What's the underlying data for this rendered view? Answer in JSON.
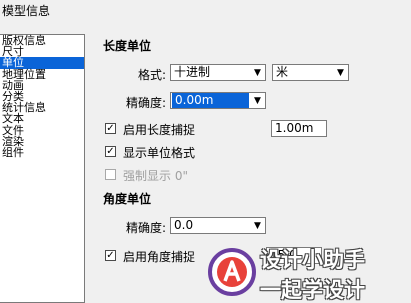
{
  "window": {
    "title": "模型信息"
  },
  "sidebar": {
    "items": [
      {
        "label": "版权信息"
      },
      {
        "label": "尺寸"
      },
      {
        "label": "单位",
        "selected": true
      },
      {
        "label": "地理位置"
      },
      {
        "label": "动画"
      },
      {
        "label": "分类"
      },
      {
        "label": "统计信息"
      },
      {
        "label": "文本"
      },
      {
        "label": "文件"
      },
      {
        "label": "渲染"
      },
      {
        "label": "组件"
      }
    ]
  },
  "length": {
    "section_title": "长度单位",
    "format_label": "格式:",
    "format_value": "十进制",
    "unit_value": "米",
    "precision_label": "精确度:",
    "precision_value": "0.00m",
    "snap_label": "启用长度捕捉",
    "snap_checked": true,
    "snap_value": "1.00m",
    "show_format_label": "显示单位格式",
    "show_format_checked": true,
    "force_label": "强制显示 0\"",
    "force_checked": false
  },
  "angle": {
    "section_title": "角度单位",
    "precision_label": "精确度:",
    "precision_value": "0.0",
    "snap_label": "启用角度捕捉",
    "snap_checked": true,
    "snap_value": "15.0"
  },
  "watermark": {
    "line1": "设计小助手",
    "line2": "一起学设计"
  },
  "icons": {
    "dropdown": "▼",
    "check": "✓"
  }
}
